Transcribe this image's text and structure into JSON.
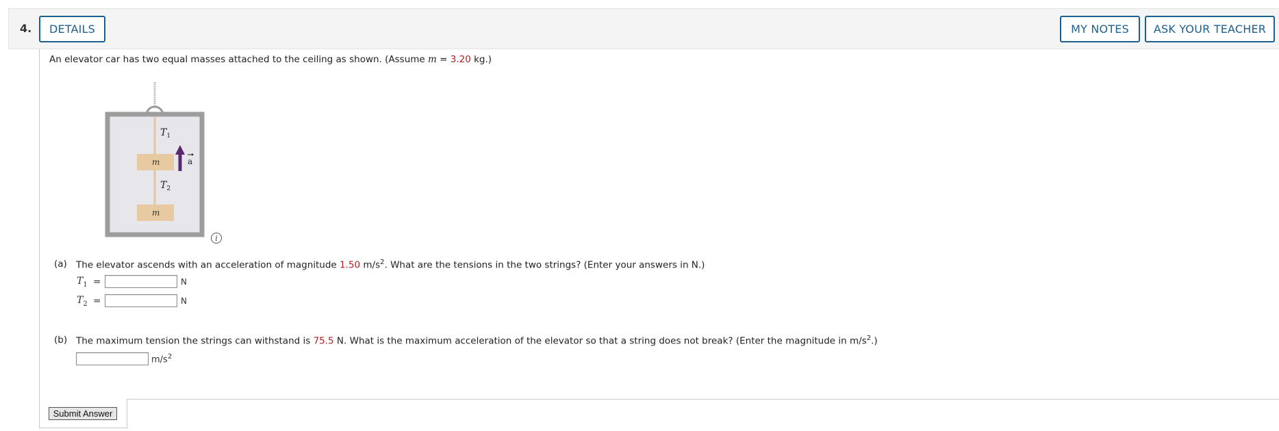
{
  "question": {
    "number": "4.",
    "details_label": "DETAILS",
    "my_notes_label": "MY NOTES",
    "ask_teacher_label": "ASK YOUR TEACHER"
  },
  "intro": {
    "text_before": "An elevator car has two equal masses attached to the ceiling as shown. (Assume ",
    "var": "m",
    "equals": " = ",
    "m_value": "3.20",
    "text_after": " kg.)"
  },
  "figure": {
    "t1_label": "T",
    "t1_sub": "1",
    "t2_label": "T",
    "t2_sub": "2",
    "mass_upper": "m",
    "mass_lower": "m",
    "accel_label": "a",
    "info_icon": "i"
  },
  "part_a": {
    "label": "(a)",
    "text_before": "The elevator ascends with an acceleration of magnitude ",
    "accel_value": "1.50",
    "text_unit": " m/s",
    "text_unit_sup": "2",
    "text_after": ". What are the tensions in the two strings? (Enter your answers in N.)",
    "t1_var": "T",
    "t1_sub": "1",
    "t2_var": "T",
    "t2_sub": "2",
    "eq": "=",
    "unit": "N",
    "t1_value": "",
    "t2_value": ""
  },
  "part_b": {
    "label": "(b)",
    "text_before": "The maximum tension the strings can withstand is ",
    "tension_value": "75.5",
    "text_after": " N. What is the maximum acceleration of the elevator so that a string does not break? (Enter the magnitude in m/s",
    "text_sup": "2",
    "text_end": ".)",
    "unit": "m/s",
    "unit_sup": "2",
    "value": ""
  },
  "submit_label": "Submit Answer"
}
